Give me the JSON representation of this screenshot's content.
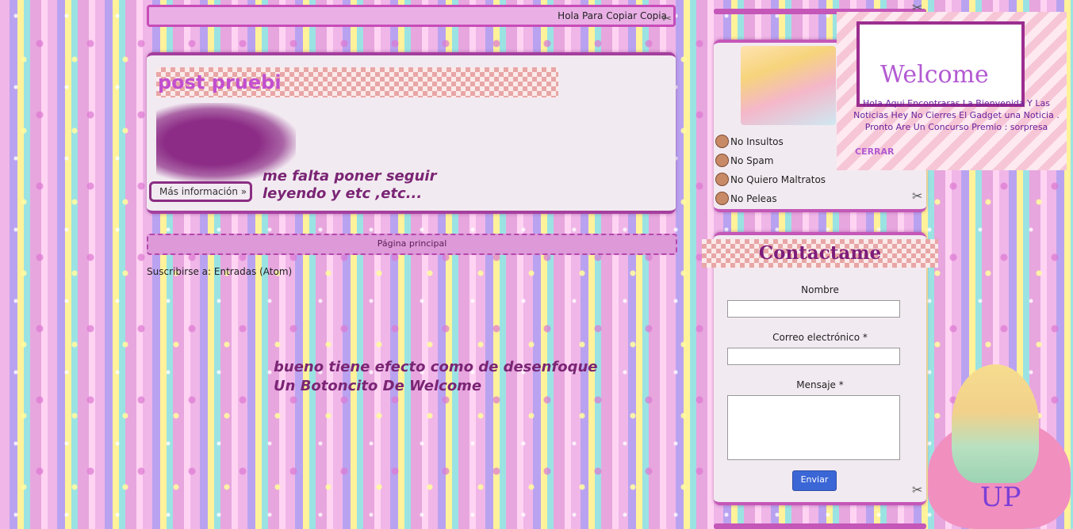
{
  "topbar": {
    "text": "Hola Para Copiar Copia"
  },
  "post": {
    "title": "post pruebi",
    "more_label": "Más información »",
    "note_line1": "me falta poner seguir",
    "note_line2": "leyendo  y etc ,etc..."
  },
  "home_label": "Página principal",
  "subscribe": {
    "prefix": "Suscribirse a:",
    "link": "Entradas (Atom)"
  },
  "big_note": {
    "line1": "bueno tiene efecto como de desenfoque",
    "line2": "Un Botoncito De Welcome"
  },
  "rules": {
    "items": [
      "No Insultos",
      "No Spam",
      "No Quiero Maltratos",
      "No Peleas"
    ]
  },
  "welcome": {
    "title": "Welcome",
    "body": "Hola Aqui Encontraras La Bienvenida Y Las Noticias Hey No Cierres El Gadget una Noticia . Pronto Are Un Concurso Premio : sorpresa",
    "close_label": "CERRAR"
  },
  "contact": {
    "title": "Contactame",
    "name_label": "Nombre",
    "email_label": "Correo electrónico *",
    "message_label": "Mensaje *",
    "send_label": "Enviar"
  },
  "up_widget": {
    "text": "UP"
  },
  "colors": {
    "accent": "#c457b8",
    "title": "#7d1d7a",
    "button": "#3b66d6"
  }
}
